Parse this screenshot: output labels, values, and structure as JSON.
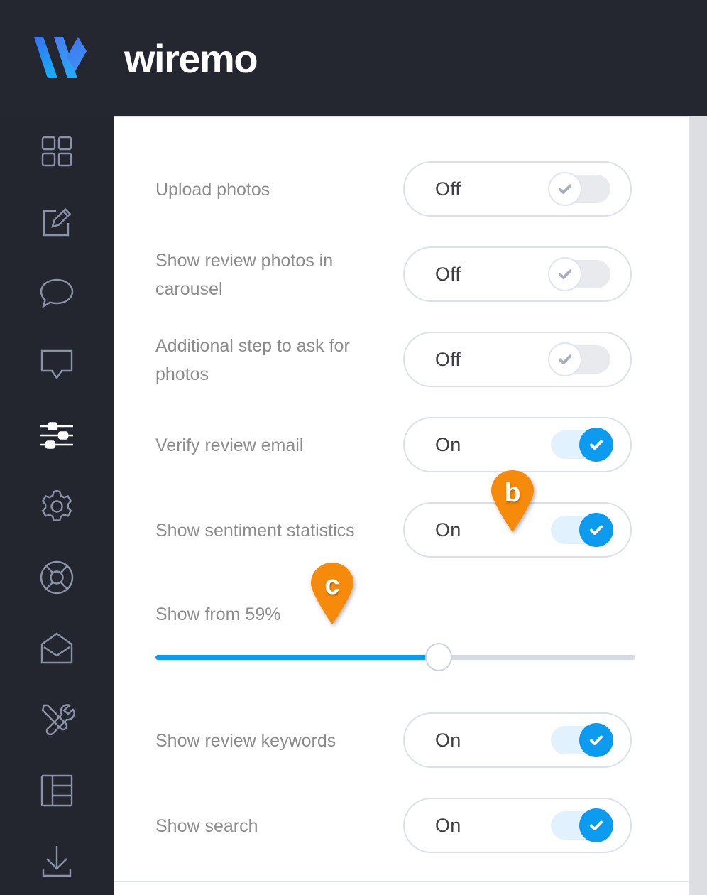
{
  "app": {
    "brand_name": "wiremo",
    "logo_icon": "wiremo-w-logo",
    "accent_blue": "#0d9bf0",
    "header_bg": "#24272f",
    "sidebar_bg": "#23262e",
    "marker_orange": "#f58a0b"
  },
  "sidebar": {
    "items": [
      {
        "id": "dashboard",
        "icon": "grid-dashboard-icon",
        "active": false
      },
      {
        "id": "compose",
        "icon": "edit-compose-icon",
        "active": false
      },
      {
        "id": "chat",
        "icon": "chat-bubble-icon",
        "active": false
      },
      {
        "id": "widget",
        "icon": "speech-banner-icon",
        "active": false
      },
      {
        "id": "settings-sliders",
        "icon": "sliders-icon",
        "active": true
      },
      {
        "id": "preferences",
        "icon": "gear-icon",
        "active": false
      },
      {
        "id": "support",
        "icon": "lifebuoy-icon",
        "active": false
      },
      {
        "id": "inbox",
        "icon": "envelope-open-icon",
        "active": false
      },
      {
        "id": "tools",
        "icon": "tools-wrench-screwdriver-icon",
        "active": false
      },
      {
        "id": "layout",
        "icon": "layout-columns-icon",
        "active": false
      },
      {
        "id": "download",
        "icon": "download-icon",
        "active": false
      }
    ]
  },
  "settings": {
    "rows": [
      {
        "id": "upload-photos",
        "label": "Upload photos",
        "state": "Off",
        "on": false
      },
      {
        "id": "show-review-photos",
        "label": "Show review photos in carousel",
        "state": "Off",
        "on": false
      },
      {
        "id": "additional-step-photos",
        "label": "Additional step to ask for photos",
        "state": "Off",
        "on": false
      },
      {
        "id": "verify-review-email",
        "label": "Verify review email",
        "state": "On",
        "on": true
      },
      {
        "id": "show-sentiment-statistics",
        "label": "Show sentiment statistics",
        "state": "On",
        "on": true
      }
    ],
    "slider": {
      "id": "show-from-threshold",
      "label": "Show from 59%",
      "value": 59,
      "min": 0,
      "max": 100,
      "unit": "%"
    },
    "rows_after_slider": [
      {
        "id": "show-review-keywords",
        "label": "Show review keywords",
        "state": "On",
        "on": true
      },
      {
        "id": "show-search",
        "label": "Show search",
        "state": "On",
        "on": true
      }
    ]
  },
  "annotations": {
    "markers": [
      {
        "id": "marker-b",
        "letter": "b",
        "target": "show-sentiment-statistics-toggle"
      },
      {
        "id": "marker-c",
        "letter": "c",
        "target": "show-from-threshold-slider"
      }
    ]
  }
}
